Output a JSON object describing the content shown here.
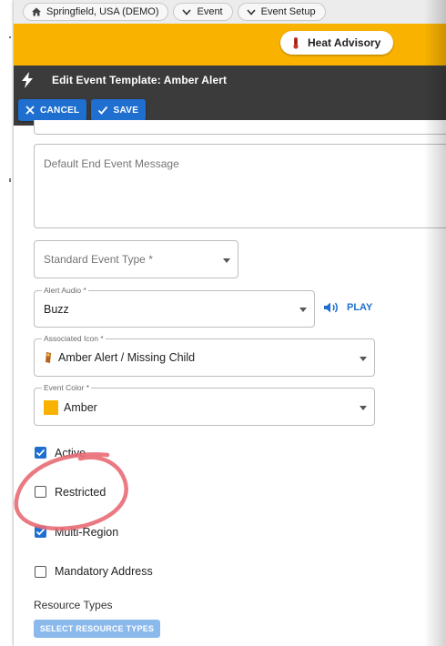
{
  "breadcrumbs": [
    {
      "label": "Springfield, USA (DEMO)",
      "icon": "home-icon"
    },
    {
      "label": "Event",
      "icon": "chevron-down-icon"
    },
    {
      "label": "Event Setup",
      "icon": "chevron-down-icon"
    }
  ],
  "header": {
    "advisory_label": "Heat Advisory",
    "advisory_icon": "thermometer-icon",
    "accent_color": "#f9b200"
  },
  "titlebar": {
    "title": "Edit Event Template: Amber Alert",
    "icon": "lightning-bolt-icon"
  },
  "toolbar": {
    "cancel_label": "CANCEL",
    "save_label": "SAVE"
  },
  "form": {
    "end_message_placeholder": "Default End Event Message",
    "event_type_placeholder": "Standard Event Type *",
    "alert_audio": {
      "label": "Alert Audio *",
      "value": "Buzz",
      "play_label": "PLAY"
    },
    "associated_icon": {
      "label": "Associated Icon *",
      "value": "Amber Alert / Missing Child"
    },
    "event_color": {
      "label": "Event Color *",
      "value": "Amber",
      "swatch": "#f9b200"
    },
    "checkboxes": [
      {
        "label": "Active",
        "checked": true
      },
      {
        "label": "Restricted",
        "checked": false
      },
      {
        "label": "Multi-Region",
        "checked": true
      },
      {
        "label": "Mandatory Address",
        "checked": false
      }
    ],
    "resource_types_label": "Resource Types",
    "select_resource_types_label": "SELECT RESOURCE TYPES"
  }
}
